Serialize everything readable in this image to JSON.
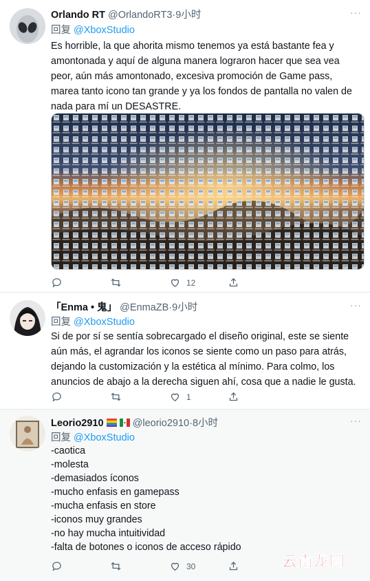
{
  "tweets": [
    {
      "name": "Orlando RT",
      "handle": "@OrlandoRT3",
      "time": "9小时",
      "reply_prefix": "回复",
      "reply_to": "@XboxStudio",
      "text_lines": [
        "Es horrible, la que ahorita mismo tenemos ya está bastante fea y",
        "amontonada y aquí de alguna manera lograron hacer que sea vea",
        "peor, aún más amontonado, excesiva promoción de Game pass,",
        "marea tanto icono tan grande y ya los fondos de pantalla no valen de",
        "nada para mí un DESASTRE."
      ],
      "likes": "12"
    },
    {
      "name": "「Enma • 鬼」",
      "handle": "@EnmaZB",
      "time": "9小时",
      "reply_prefix": "回复",
      "reply_to": "@XboxStudio",
      "text_lines": [
        "Si de por sí se sentía sobrecargado el diseño original, este se siente",
        "aún más, el agrandar los iconos se siente como un paso para atrás,",
        "dejando la customización y la estética al mínimo. Para colmo, los",
        "anuncios de abajo a la derecha siguen ahí, cosa que a nadie le gusta."
      ],
      "likes": "1"
    },
    {
      "name": "Leorio2910",
      "handle": "@leorio2910",
      "time": "8小时",
      "reply_prefix": "回复",
      "reply_to": "@XboxStudio",
      "text_lines": [
        "-caotica",
        "-molesta",
        "-demasiados íconos",
        "-mucho enfasis en gamepass",
        "-mucha enfasis en store",
        "-iconos muy grandes",
        "-no hay mucha intuitividad",
        "-falta de botones o iconos de acceso rápido"
      ],
      "likes": "30"
    }
  ],
  "separator": "·",
  "more_glyph": "···",
  "watermark": "云南龙网",
  "colors": {
    "link": "#1d9bf0",
    "secondary": "#536471",
    "divider": "#e1e6ea",
    "watermark": "#e02020",
    "highlight_bg": "#f7f9f9"
  },
  "icons": {
    "reply": "reply-icon",
    "retweet": "retweet-icon",
    "like": "like-icon",
    "share": "share-icon",
    "more": "more-icon"
  }
}
